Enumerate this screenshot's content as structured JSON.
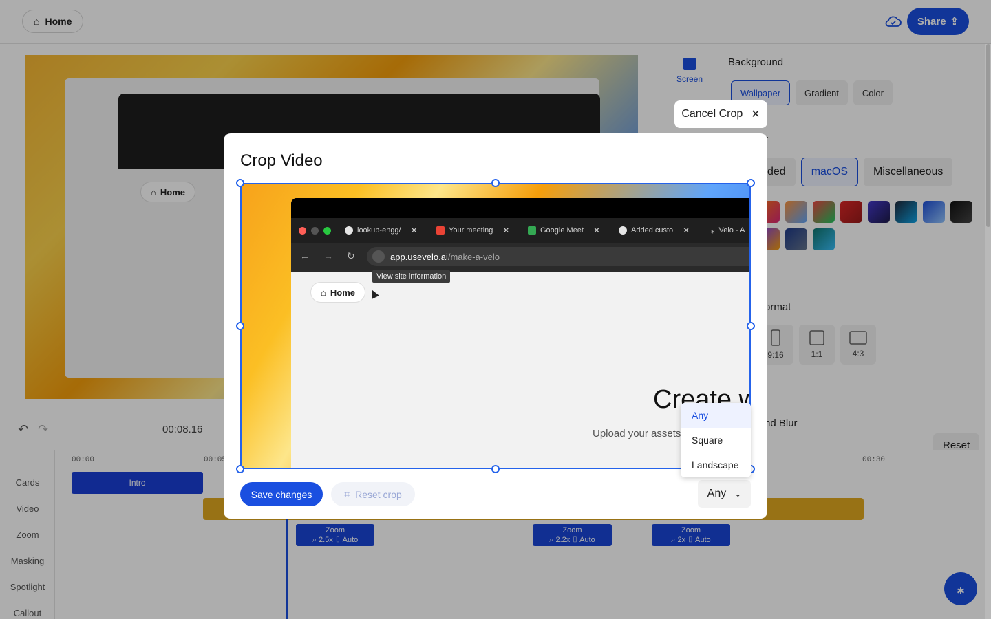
{
  "topbar": {
    "home_label": "Home",
    "share_label": "Share"
  },
  "preview": {
    "home_label": "Home"
  },
  "tools": {
    "screen_label": "Screen"
  },
  "panel": {
    "background_title": "Background",
    "bg_tabs": [
      "Wallpaper",
      "Gradient",
      "Color"
    ],
    "wallpaper_sub_label": "r",
    "wallpaper_tabs": [
      "ded",
      "macOS",
      "Miscellaneous"
    ],
    "format_label": "ormat",
    "formats": [
      "9:16",
      "1:1",
      "4:3"
    ],
    "blur_label": "nd Blur",
    "reset_label": "Reset"
  },
  "playback": {
    "timecode": "00:08.16"
  },
  "timeline": {
    "tracks": [
      "Cards",
      "Video",
      "Zoom",
      "Masking",
      "Spotlight",
      "Callout"
    ],
    "ruler": [
      "00:00",
      "00:05",
      "00:30"
    ],
    "intro_label": "Intro",
    "zoom_clips": [
      {
        "title": "Zoom",
        "level": "2.5x",
        "mode": "Auto"
      },
      {
        "title": "Zoom",
        "level": "2.2x",
        "mode": "Auto"
      },
      {
        "title": "Zoom",
        "level": "2x",
        "mode": "Auto"
      }
    ]
  },
  "crop": {
    "cancel_label": "Cancel Crop",
    "title": "Crop Video",
    "save_label": "Save changes",
    "reset_label": "Reset crop",
    "ratio_value": "Any",
    "ratio_options": [
      "Any",
      "Square",
      "Landscape"
    ],
    "recording": {
      "tabs": [
        "lookup-engg/",
        "Your meeting",
        "Google Meet",
        "Added custo",
        "Velo - A"
      ],
      "url_host": "app.usevelo.ai",
      "url_path": "/make-a-velo",
      "tooltip": "View site information",
      "home_label": "Home",
      "headline": "Create w",
      "subtext": "Upload your assets"
    }
  },
  "colors": {
    "accent": "#1a4fe0",
    "clip_video": "#e0a81f"
  }
}
